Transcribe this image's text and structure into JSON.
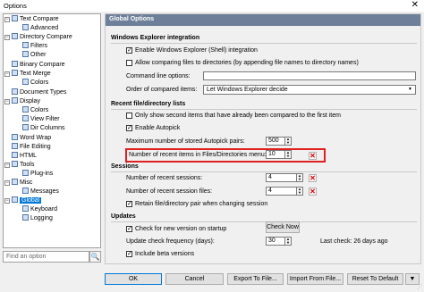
{
  "window": {
    "title": "Options",
    "close_symbol": "✕"
  },
  "tree": {
    "items": [
      {
        "label": "Text Compare"
      },
      {
        "label": "Advanced"
      },
      {
        "label": "Directory Compare"
      },
      {
        "label": "Filters"
      },
      {
        "label": "Other"
      },
      {
        "label": "Binary Compare"
      },
      {
        "label": "Text Merge"
      },
      {
        "label": "Colors"
      },
      {
        "label": "Document Types"
      },
      {
        "label": "Display"
      },
      {
        "label": "Colors"
      },
      {
        "label": "View Filter"
      },
      {
        "label": "Dir Columns"
      },
      {
        "label": "Word Wrap"
      },
      {
        "label": "File Editing"
      },
      {
        "label": "HTML"
      },
      {
        "label": "Tools"
      },
      {
        "label": "Plug-ins"
      },
      {
        "label": "Misc"
      },
      {
        "label": "Messages"
      },
      {
        "label": "Global",
        "selected": true
      },
      {
        "label": "Keyboard"
      },
      {
        "label": "Logging"
      }
    ],
    "search_placeholder": "Find an option",
    "search_icon": "🔍"
  },
  "panel": {
    "header": "Global Options",
    "explorer": {
      "title": "Windows Explorer integration",
      "enable_shell": {
        "label": "Enable Windows Explorer (Shell) integration",
        "checked": true
      },
      "allow_comparing": {
        "label": "Allow comparing files to directories (by appending file names to directory names)",
        "checked": false
      },
      "command_line_label": "Command line options:",
      "command_line_value": "",
      "order_label": "Order of compared items:",
      "order_value": "Let Windows Explorer decide"
    },
    "recent": {
      "title": "Recent file/directory lists",
      "only_show": {
        "label": "Only show second items that have already been compared to the first item",
        "checked": false
      },
      "enable_autopick": {
        "label": "Enable Autopick",
        "checked": true
      },
      "max_autopick_label": "Maximum number of stored Autopick pairs:",
      "max_autopick_value": "500",
      "recent_menu_label": "Number of recent items in Files/Directories menu:",
      "recent_menu_value": "10"
    },
    "sessions": {
      "title": "Sessions",
      "recent_sessions_label": "Number of recent sessions:",
      "recent_sessions_value": "4",
      "recent_session_files_label": "Number of recent session files:",
      "recent_session_files_value": "4",
      "retain": {
        "label": "Retain file/directory pair when changing session",
        "checked": true
      }
    },
    "updates": {
      "title": "Updates",
      "check_new": {
        "label": "Check for new version on startup",
        "checked": true
      },
      "check_now_label": "Check Now",
      "frequency_label": "Update check frequency (days):",
      "frequency_value": "30",
      "last_check": "Last check: 26 days ago",
      "include_beta": {
        "label": "Include beta versions",
        "checked": true
      }
    }
  },
  "footer": {
    "ok": "OK",
    "cancel": "Cancel",
    "export": "Export To File...",
    "import": "Import From File...",
    "reset": "Reset To Default",
    "dropdown_arrow": "▼",
    "grip": "⋰"
  },
  "colors": {
    "header_bg": "#6d7f99",
    "selection": "#0078d7",
    "highlight": "#e02020"
  }
}
